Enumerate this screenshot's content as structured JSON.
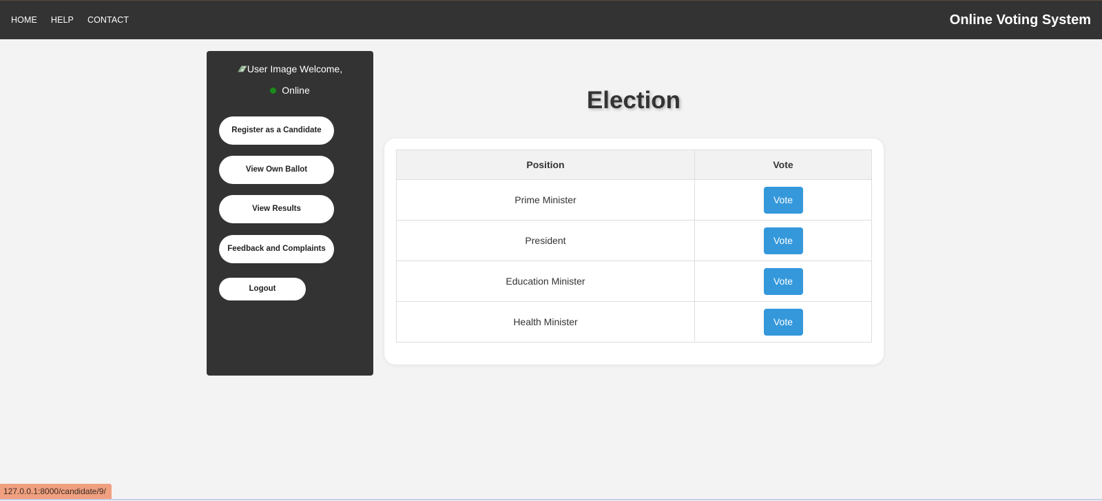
{
  "nav": {
    "links": [
      "HOME",
      "HELP",
      "CONTACT"
    ],
    "brand": "Online Voting System"
  },
  "sidebar": {
    "user_image_alt": "User Image",
    "welcome": "Welcome,",
    "status": "Online",
    "buttons": [
      "Register as a Candidate",
      "View Own Ballot",
      "View Results",
      "Feedback and Complaints"
    ],
    "logout": "Logout"
  },
  "main": {
    "title": "Election",
    "table": {
      "headers": [
        "Position",
        "Vote"
      ],
      "rows": [
        {
          "position": "Prime Minister",
          "action": "Vote"
        },
        {
          "position": "President",
          "action": "Vote"
        },
        {
          "position": "Education Minister",
          "action": "Vote"
        },
        {
          "position": "Health Minister",
          "action": "Vote"
        }
      ]
    }
  },
  "status_bar": {
    "url": "127.0.0.1:8000/candidate/9/"
  },
  "colors": {
    "navbar": "#333333",
    "sidebar": "#333333",
    "vote_button": "#3498db",
    "online_dot": "#1a8a1a",
    "background": "#f3f3f3"
  }
}
